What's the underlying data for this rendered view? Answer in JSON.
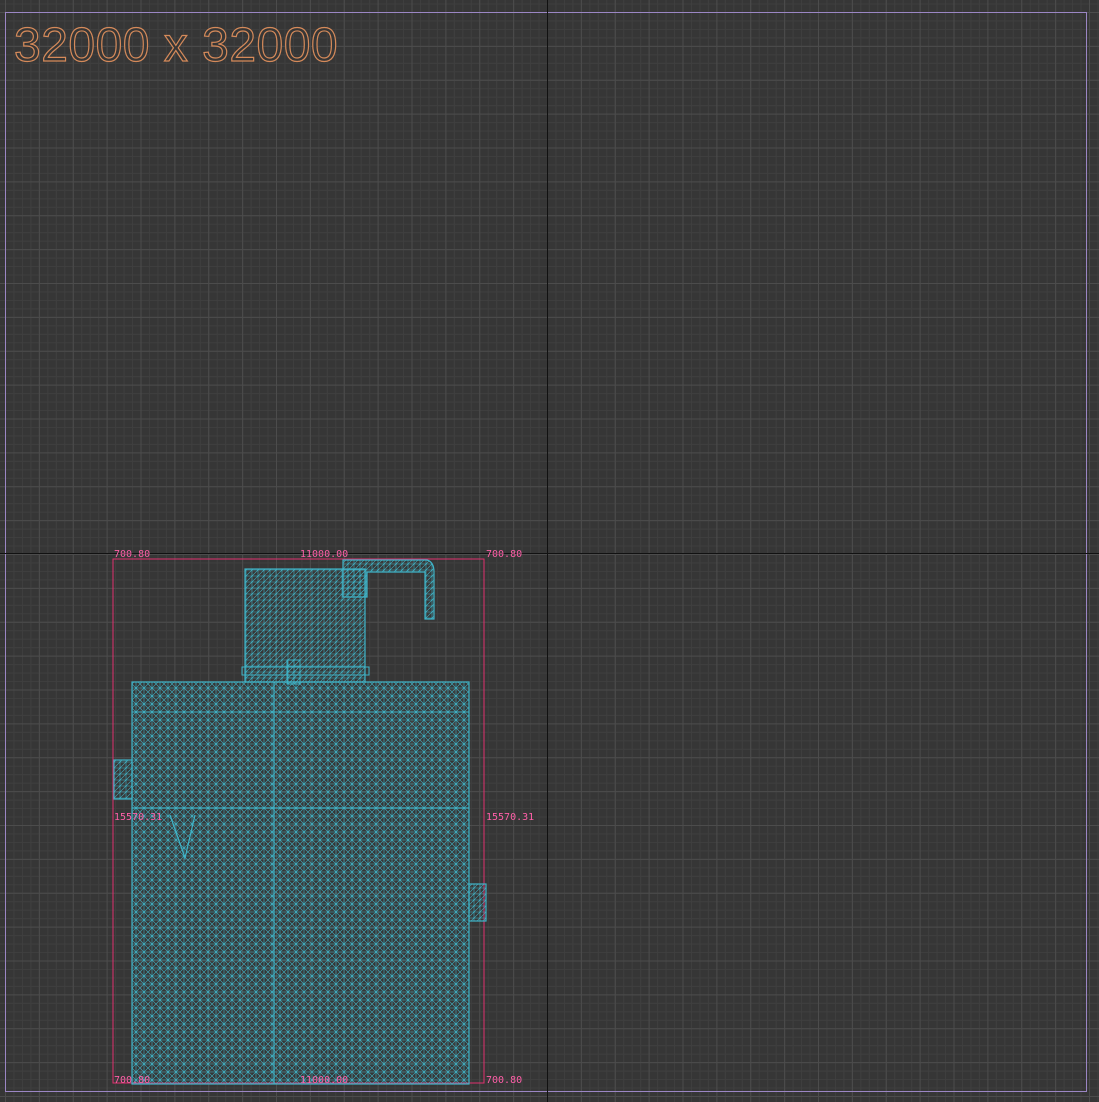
{
  "viewport": {
    "size_label": "32000 x 32000",
    "background_color": "#363636",
    "grid_color": "#4c4c4c",
    "axis_color": "#111111",
    "bounds_color": "#9b86c4"
  },
  "mesh": {
    "color": "#3fb4c8",
    "bounding_box_color": "#e0306f"
  },
  "dimensions": {
    "top_left": "700.80",
    "top_center": "11000.00",
    "top_right": "700.80",
    "mid_left": "15570.31",
    "mid_right": "15570.31",
    "bottom_left": "700.80",
    "bottom_center": "11000.00",
    "bottom_right": "700.80"
  }
}
